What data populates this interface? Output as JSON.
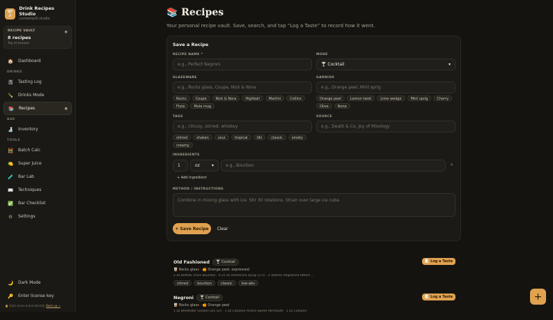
{
  "brand": {
    "title": "Drink Recipes Studio",
    "subtitle": "contempt0.studio",
    "logo": "cocktail-glass-icon"
  },
  "vault": {
    "label": "RECIPE VAULT",
    "count": "8 recipes",
    "hint": "Tap to browse"
  },
  "nav": {
    "dashboard": "Dashboard",
    "drinks_section": "DRINKS",
    "tasting_log": "Tasting Log",
    "drinks_mode": "Drinks Mode",
    "recipes": "Recipes",
    "bar_section": "BAR",
    "inventory": "Inventory",
    "tools_section": "TOOLS",
    "batch_calc": "Batch Calc",
    "super_juice": "Super Juice",
    "bar_lab": "Bar Lab",
    "techniques": "Techniques",
    "bar_checklist": "Bar Checklist",
    "settings": "Settings"
  },
  "footer": {
    "dark_mode": "Dark Mode",
    "license": "Enter license key",
    "note": "Data saves automatically.",
    "note_link": "Back up →"
  },
  "header": {
    "title": "Recipes",
    "subtitle": "Your personal recipe vault. Save, search, and tap “Log a Taste” to record how it went."
  },
  "form": {
    "title": "Save a Recipe",
    "name_label": "RECIPE NAME *",
    "name_placeholder": "e.g., Perfect Negroni",
    "mode_label": "MODE",
    "mode_value": "🍸 Cocktail",
    "glass_label": "GLASSWARE",
    "glass_placeholder": "e.g., Rocks glass, Coupe, Nick & Nora",
    "glass_chips": [
      "Rocks",
      "Coupe",
      "Nick & Nora",
      "Highball",
      "Martini",
      "Collins",
      "Flute",
      "Mule mug"
    ],
    "garnish_label": "GARNISH",
    "garnish_placeholder": "e.g., Orange peel, Mint sprig",
    "garnish_chips": [
      "Orange peel",
      "Lemon twist",
      "Lime wedge",
      "Mint sprig",
      "Cherry",
      "Olive",
      "None"
    ],
    "tags_label": "TAGS",
    "tags_placeholder": "e.g., citrusy, stirred, whiskey",
    "tag_chips": [
      "stirred",
      "shaken",
      "sour",
      "tropical",
      "tiki",
      "classic",
      "smoky",
      "creamy"
    ],
    "source_label": "SOURCE",
    "source_placeholder": "e.g., Death & Co, Joy of Mixology",
    "ingredients_label": "INGREDIENTS",
    "ing_qty": "1",
    "ing_unit": "oz",
    "ing_placeholder": "e.g., Bourbon",
    "add_ingredient": "+ Add Ingredient",
    "method_label": "METHOD / INSTRUCTIONS",
    "method_placeholder": "Combine in mixing glass with ice. Stir 30 rotations. Strain over large ice cube.",
    "save": "+ Save Recipe",
    "clear": "Clear"
  },
  "recipes": [
    {
      "name": "Old Fashioned",
      "mode": "🍸 Cocktail",
      "meta": "🥃 Rocks glass · 🍊 Orange peel, expressed",
      "ingredients": "2 oz Buffalo Trace Bourbon · 0.25 oz Demerara syrup (2:1) · 2 dashes Angostura bitters ...",
      "tags": [
        "stirred",
        "bourbon",
        "classic",
        "low-abv"
      ],
      "log": "📝 Log a Taste"
    },
    {
      "name": "Negroni",
      "mode": "🍸 Cocktail",
      "meta": "🥃 Rocks glass · 🍊 Orange peel",
      "ingredients": "1 oz Beefeater London Dry Gin · 1 oz Carpano Antica Sweet Vermouth · 1 oz Campari",
      "tags": [],
      "log": "📝 Log a Taste"
    }
  ],
  "colors": {
    "accent": "#e0a24f",
    "background": "#141310",
    "sidebar": "#1a1916",
    "card": "#1b1a17"
  }
}
